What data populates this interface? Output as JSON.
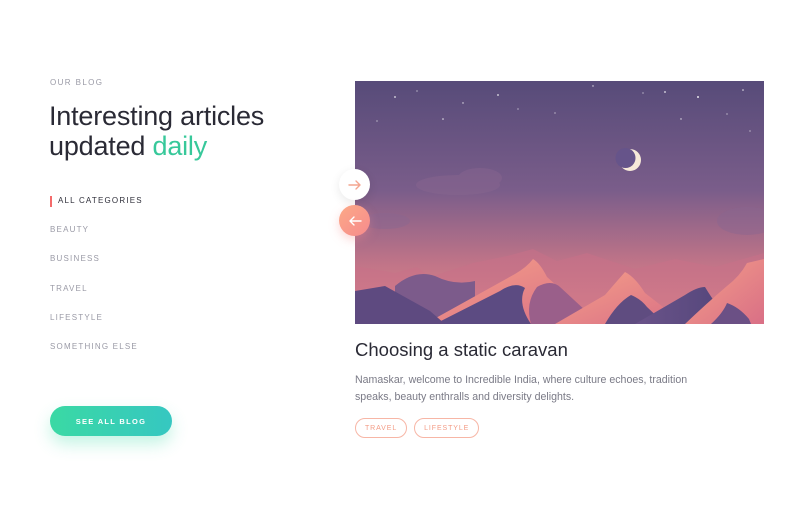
{
  "blog": {
    "eyebrow": "OUR BLOG",
    "headline_line1": "Interesting articles",
    "headline_line2_prefix": "updated ",
    "headline_accent": "daily",
    "accent_color": "#37c89a"
  },
  "categories": [
    {
      "label": "ALL CATEGORIES",
      "active": true
    },
    {
      "label": "BEAUTY"
    },
    {
      "label": "BUSINESS"
    },
    {
      "label": "TRAVEL"
    },
    {
      "label": "LIFESTYLE"
    },
    {
      "label": "SOMETHING ELSE"
    }
  ],
  "cta": {
    "label": "SEE ALL BLOG"
  },
  "carousel": {
    "next_icon": "arrow-right-icon",
    "prev_icon": "arrow-left-icon"
  },
  "article": {
    "title": "Choosing a static caravan",
    "body": "Namaskar, welcome to Incredible India, where culture echoes, tradition speaks, beauty enthralls and diversity delights.",
    "tags": [
      "TRAVEL",
      "LIFESTYLE"
    ]
  }
}
